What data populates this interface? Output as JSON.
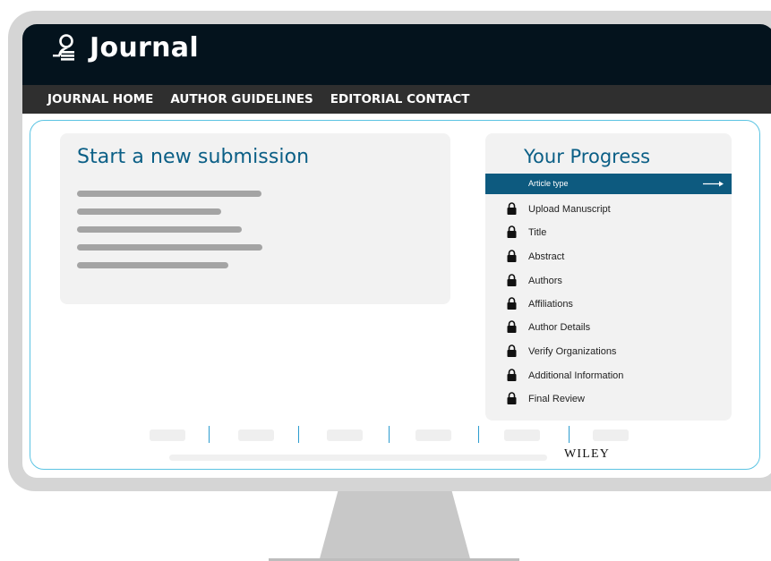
{
  "header": {
    "brand_name": "Journal",
    "brand_icon": "reader-icon"
  },
  "nav": {
    "items": [
      "JOURNAL HOME",
      "AUTHOR GUIDELINES",
      "EDITORIAL CONTACT"
    ]
  },
  "submission": {
    "title": "Start a new submission"
  },
  "progress": {
    "title": "Your Progress",
    "active_step": "Article type",
    "active_icon": "arrow-right-icon",
    "steps": [
      "Upload Manuscript",
      "Title",
      "Abstract",
      "Authors",
      "Affiliations",
      "Author Details",
      "Verify Organizations",
      "Additional Information",
      "Final Review"
    ],
    "step_icon": "lock-icon"
  },
  "footer": {
    "publisher": "WILEY"
  },
  "colors": {
    "header_bg": "#04131d",
    "nav_bg": "#2f2f2f",
    "accent": "#0b5f86",
    "active_step_bg": "#0d5a7f",
    "frame_border": "#5bc4e3"
  }
}
